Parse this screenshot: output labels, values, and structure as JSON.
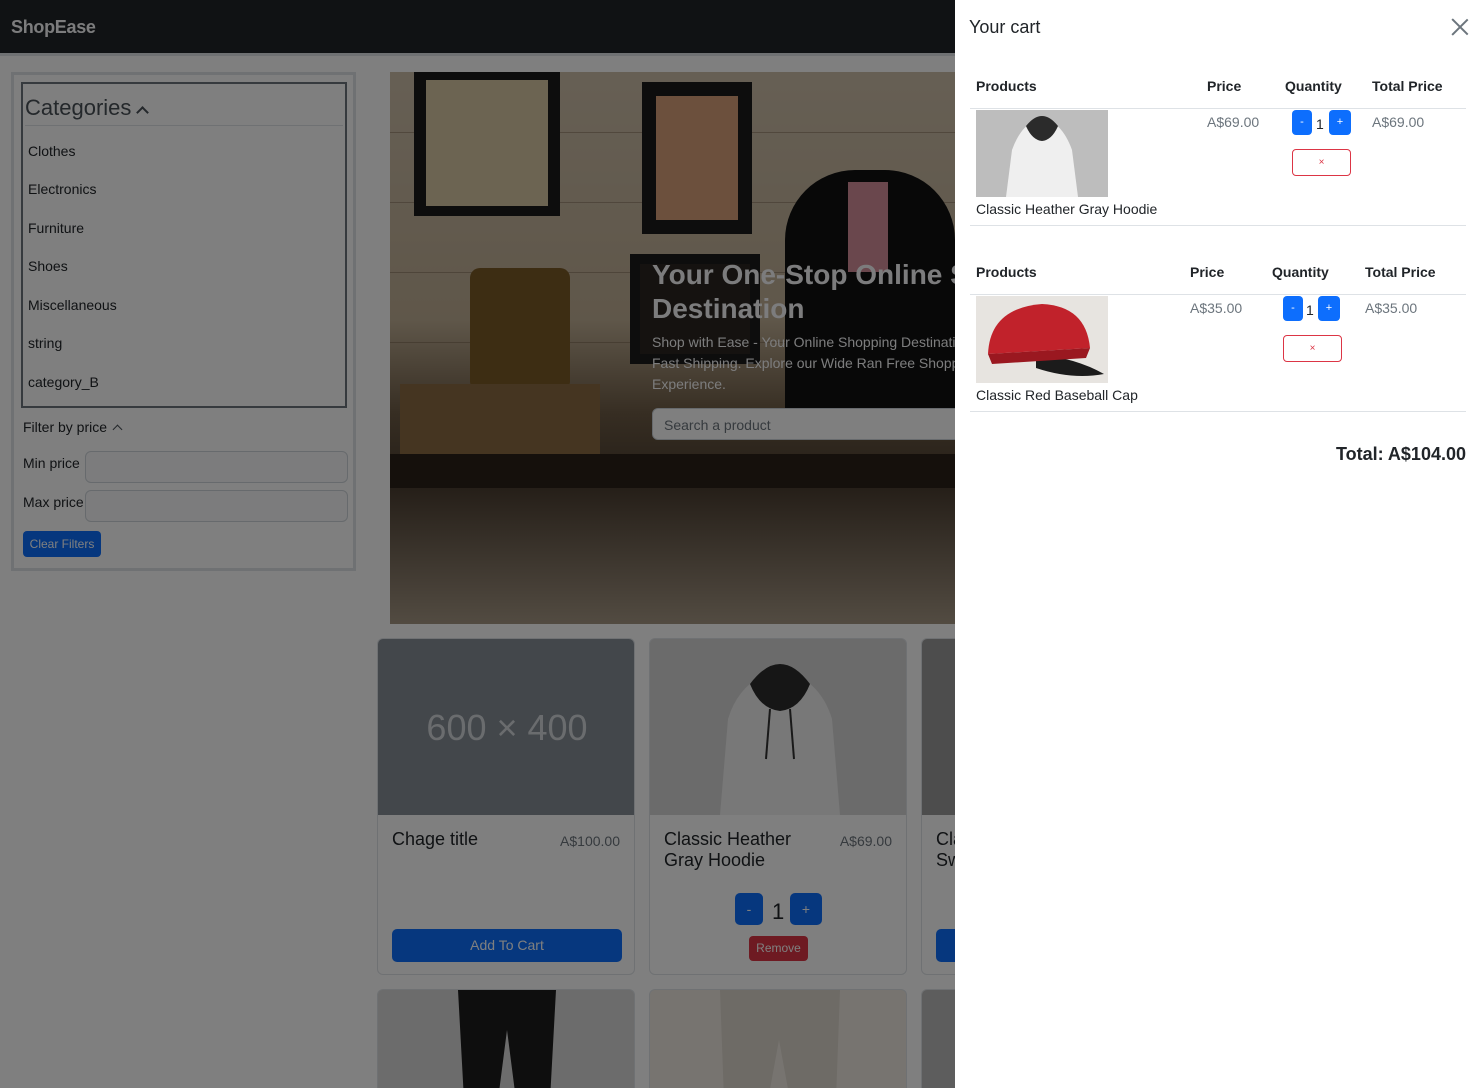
{
  "navbar": {
    "brand": "ShopEase"
  },
  "sidebar": {
    "categories_title": "Categories",
    "categories": [
      "Clothes",
      "Electronics",
      "Furniture",
      "Shoes",
      "Miscellaneous",
      "string",
      "category_B"
    ],
    "filter_title": "Filter by price",
    "min_price_label": "Min price",
    "max_price_label": "Max price",
    "clear_filters_label": "Clear Filters"
  },
  "hero": {
    "title_line1": "Your One-Stop Online S",
    "title_line2": "Destination",
    "text": "Shop with Ease - Your Online Shopping Destinati Checkout & Fast Shipping. Explore our Wide Ran Free Shopping Experience.",
    "search_placeholder": "Search a product"
  },
  "products": [
    {
      "image_text": "600 × 400",
      "title": "Chage title",
      "price": "A$100.00",
      "action": "Add To Cart"
    },
    {
      "title": "Classic Heather Gray Hoodie",
      "price": "A$69.00",
      "minus": "-",
      "quantity": "1",
      "plus": "+",
      "remove": "Remove"
    },
    {
      "title": "Cla Sw"
    }
  ],
  "cart": {
    "title": "Your cart",
    "headers": {
      "products": "Products",
      "price": "Price",
      "quantity": "Quantity",
      "total": "Total Price"
    },
    "items": [
      {
        "name": "Classic Heather Gray Hoodie",
        "price": "A$69.00",
        "minus": "-",
        "quantity": "1",
        "plus": "+",
        "remove": "×",
        "total": "A$69.00"
      },
      {
        "name": "Classic Red Baseball Cap",
        "price": "A$35.00",
        "minus": "-",
        "quantity": "1",
        "plus": "+",
        "remove": "×",
        "total": "A$35.00"
      }
    ],
    "grand_total": "Total: A$104.00"
  },
  "colors": {
    "primary": "#0d6efd",
    "danger": "#dc3545",
    "dark": "#212529"
  }
}
